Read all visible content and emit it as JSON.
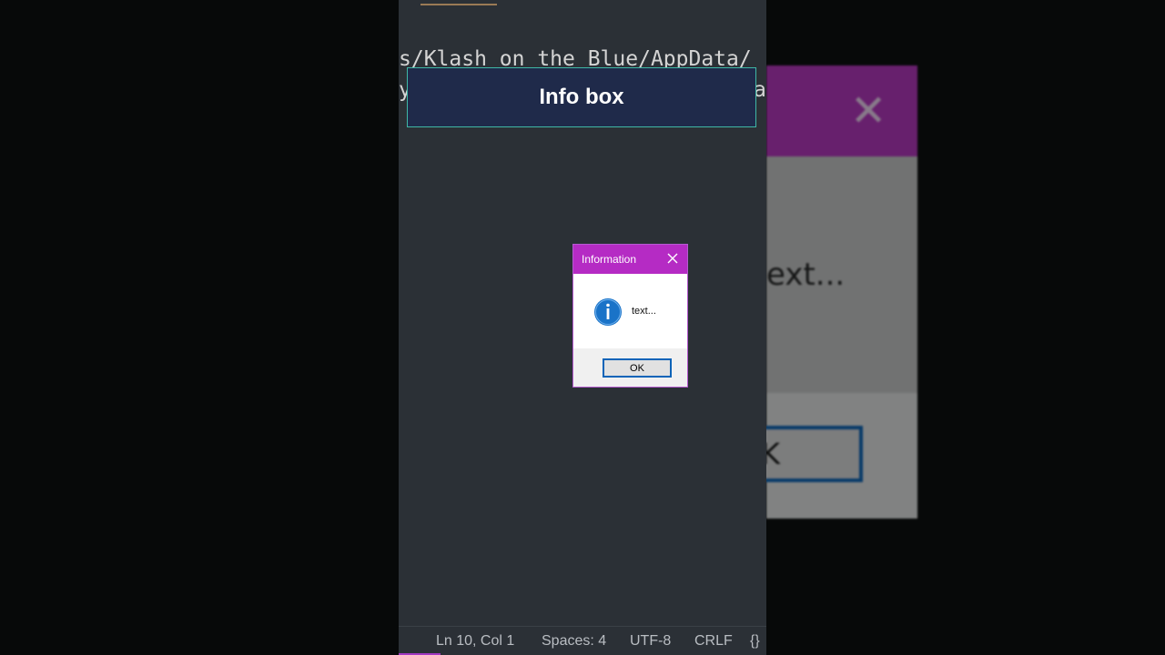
{
  "editor": {
    "code_line_1": "s/Klash on the Blue/AppData/",
    "code_line_2_start": "y",
    "code_line_2_end": "a"
  },
  "banner": {
    "title": "Info box"
  },
  "dialog": {
    "title": "Information",
    "message": "text...",
    "ok_label": "OK"
  },
  "blurred_dialog": {
    "text": "ext...",
    "ok_label": "K"
  },
  "statusbar": {
    "position": "Ln 10, Col 1",
    "spaces": "Spaces: 4",
    "encoding": "UTF-8",
    "line_ending": "CRLF",
    "language_icon": "{}"
  },
  "colors": {
    "title_bar": "#b52bc4",
    "button_border": "#0a64b8",
    "editor_bg": "#2b3036",
    "banner_bg": "#1f2a4a"
  }
}
